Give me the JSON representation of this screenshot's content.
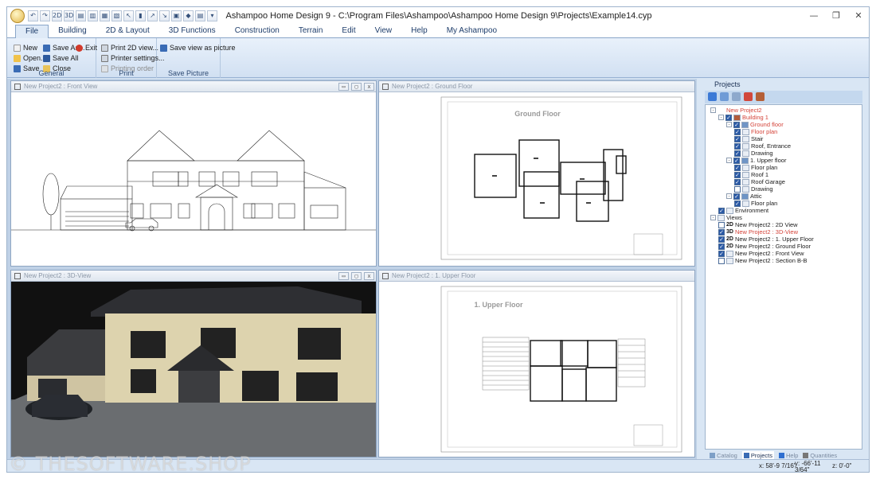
{
  "window": {
    "title": "Ashampoo Home Design 9 - C:\\Program Files\\Ashampoo\\Ashampoo Home Design 9\\Projects\\Example14.cyp",
    "minimize": "—",
    "restore": "❐",
    "close": "✕"
  },
  "quick_access": [
    "↶",
    "↷",
    "2D",
    "3D",
    "▤",
    "▥",
    "▦",
    "▧",
    "↖",
    "▮",
    "↗",
    "↘",
    "▣",
    "◆",
    "▤",
    "▾"
  ],
  "ribbon_tabs": [
    "File",
    "Building",
    "2D & Layout",
    "3D Functions",
    "Construction",
    "Terrain",
    "Edit",
    "View",
    "Help",
    "My Ashampoo"
  ],
  "ribbon": {
    "general": {
      "title": "General",
      "new": "New",
      "open": "Open...",
      "save": "Save",
      "save_as": "Save As...",
      "save_all": "Save All",
      "close": "Close",
      "exit": "Exit"
    },
    "print": {
      "title": "Print",
      "print_2d": "Print 2D view...",
      "printer_settings": "Printer settings...",
      "printing_order": "Printing order"
    },
    "save_picture": {
      "title": "Save Picture",
      "save_view": "Save view as picture"
    }
  },
  "panes": {
    "front": {
      "title": "New Project2 : Front View"
    },
    "ground": {
      "title": "New Project2 : Ground Floor",
      "label": "Ground Floor"
    },
    "view3d": {
      "title": "New Project2 : 3D-View"
    },
    "upper": {
      "title": "New Project2 : 1. Upper Floor",
      "label": "1. Upper Floor"
    }
  },
  "pane_controls": {
    "min": "▭",
    "max": "▢",
    "close": "x"
  },
  "projects_panel": {
    "title": "Projects",
    "tree": [
      {
        "label": "New Project2",
        "red": true
      },
      {
        "label": "Building 1",
        "red": true
      },
      {
        "label": "Ground floor",
        "red": true
      },
      {
        "label": "Floor plan",
        "red": true
      },
      {
        "label": "Stair"
      },
      {
        "label": "Roof, Entrance"
      },
      {
        "label": "Drawing"
      },
      {
        "label": "1. Upper floor"
      },
      {
        "label": "Floor plan"
      },
      {
        "label": "Roof 1"
      },
      {
        "label": "Roof Garage"
      },
      {
        "label": "Drawing"
      },
      {
        "label": "Attic"
      },
      {
        "label": "Floor plan"
      },
      {
        "label": "Environment"
      },
      {
        "label": "Views"
      },
      {
        "label": "New Project2 : 2D View",
        "tag": "2D"
      },
      {
        "label": "New Project2 : 3D-View",
        "tag": "3D",
        "red": true
      },
      {
        "label": "New Project2 : 1. Upper Floor",
        "tag": "2D"
      },
      {
        "label": "New Project2 : Ground Floor",
        "tag": "2D"
      },
      {
        "label": "New Project2 : Front View"
      },
      {
        "label": "New Project2 : Section B-B"
      }
    ],
    "tabs": [
      "Catalog",
      "Projects",
      "Help",
      "Quantities"
    ]
  },
  "statusbar": {
    "x": "x: 58'-9 7/16\"",
    "y1": "y: -66'-11",
    "y2": "3/64\"",
    "z": "z: 0'-0\""
  },
  "watermark": "© THESOFTWARE.SHOP"
}
